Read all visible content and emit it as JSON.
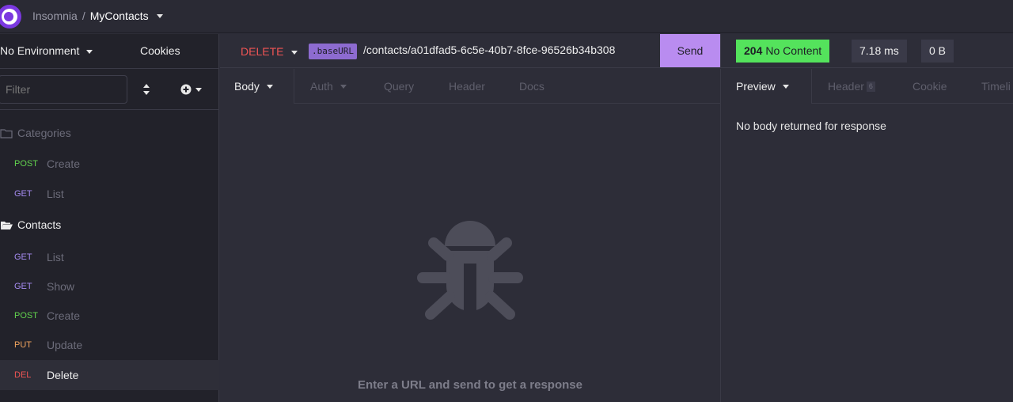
{
  "app": {
    "name": "Insomnia",
    "separator": "/",
    "workspace": "MyContacts"
  },
  "sidebar": {
    "environment": "No Environment",
    "cookies": "Cookies",
    "filter_placeholder": "Filter",
    "folders": [
      {
        "label": "Categories",
        "expanded": false
      },
      {
        "label": "Contacts",
        "expanded": true
      }
    ],
    "requests": [
      {
        "method": "POST",
        "name": "Create"
      },
      {
        "method": "GET",
        "name": "List"
      },
      {
        "method": "GET",
        "name": "List"
      },
      {
        "method": "GET",
        "name": "Show"
      },
      {
        "method": "POST",
        "name": "Create"
      },
      {
        "method": "PUT",
        "name": "Update"
      },
      {
        "method": "DEL",
        "name": "Delete"
      }
    ]
  },
  "request": {
    "method": "DELETE",
    "base_tag": ".baseURL",
    "path": "/contacts/a01dfad5-6c5e-40b7-8fce-96526b34b308",
    "send_label": "Send",
    "tabs": [
      "Body",
      "Auth",
      "Query",
      "Header",
      "Docs"
    ],
    "empty_hint": "Enter a URL and send to get a response"
  },
  "response": {
    "status_code": "204",
    "status_text": "No Content",
    "time": "7.18 ms",
    "size": "0 B",
    "tabs": [
      "Preview",
      "Header",
      "Cookie",
      "Timeli"
    ],
    "header_count": "6",
    "body_message": "No body returned for response"
  },
  "colors": {
    "accent": "#7b38e0",
    "send": "#b98cf0",
    "status_ok": "#54e35c",
    "delete": "#ee5454",
    "post": "#62d34e",
    "get": "#a58bf0",
    "put": "#f0a45e"
  }
}
